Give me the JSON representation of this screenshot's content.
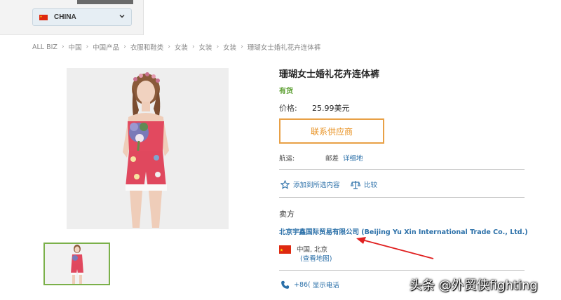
{
  "header": {
    "country": "CHINA"
  },
  "breadcrumb": [
    "ALL BIZ",
    "中国",
    "中国产品",
    "衣服和鞋类",
    "女装",
    "女装",
    "女装",
    "珊瑚女士婚礼花卉连体裤"
  ],
  "product": {
    "title": "珊瑚女士婚礼花卉连体裤",
    "stock": "有货",
    "price_label": "价格:",
    "price": "25.99美元",
    "contact_button": "联系供应商",
    "shipping_label": "航运:",
    "shipping_method": "邮差",
    "shipping_detail": "详细地",
    "add_favorite": "添加到所选内容",
    "compare": "比较"
  },
  "seller": {
    "heading": "卖方",
    "name": "北京宇鑫国际贸易有限公司 (Beijing Yu Xin International Trade Co., Ltd.)",
    "location": "中国, 北京",
    "map_link": "(查看地图)",
    "phone_prefix": "+86(",
    "phone_link": "显示电话"
  },
  "watermark": "头条 @外贸侠fighting",
  "colors": {
    "link": "#2a6fa8",
    "accent": "#e8a046",
    "stock": "#5a9e2f",
    "annotation": "#e02020"
  }
}
